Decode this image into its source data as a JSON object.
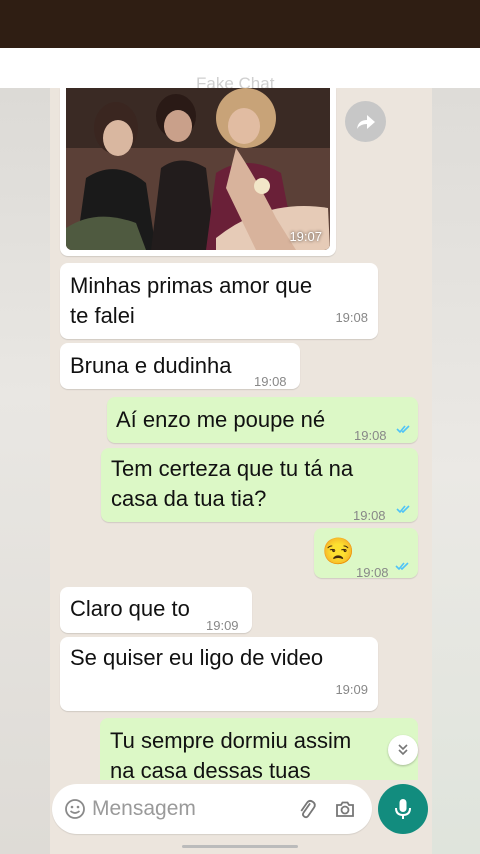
{
  "header": {
    "title": "Fake Chat"
  },
  "image_message": {
    "time": "19:07"
  },
  "messages": [
    {
      "side": "in",
      "text": "Minhas primas amor que\nte falei",
      "time": "19:08"
    },
    {
      "side": "in",
      "text": "Bruna e dudinha",
      "time": "19:08"
    },
    {
      "side": "out",
      "text": "Aí enzo me poupe né",
      "time": "19:08"
    },
    {
      "side": "out",
      "text": "Tem certeza que tu tá na\ncasa da tua tia?",
      "time": "19:08"
    },
    {
      "side": "out",
      "text": "😒",
      "time": "19:08"
    },
    {
      "side": "in",
      "text": "Claro que to",
      "time": "19:09"
    },
    {
      "side": "in",
      "text": "Se quiser eu ligo de video",
      "time": "19:09"
    },
    {
      "side": "out",
      "text": "Tu sempre dormiu assim\nna casa dessas tuas",
      "time": ""
    }
  ],
  "input": {
    "placeholder": "Mensagem"
  },
  "icons": {
    "forward": "forward-icon",
    "emoji": "emoji-icon",
    "attach": "paperclip-icon",
    "camera": "camera-icon",
    "mic": "mic-icon",
    "scroll_down": "double-chevron-down-icon",
    "read_receipt": "double-check-icon"
  },
  "colors": {
    "topbar": "#2f1e13",
    "chat_bg": "#ece5dd",
    "incoming": "#ffffff",
    "outgoing": "#dcf8c6",
    "mic": "#128c7e",
    "tick": "#4fc3f7"
  }
}
